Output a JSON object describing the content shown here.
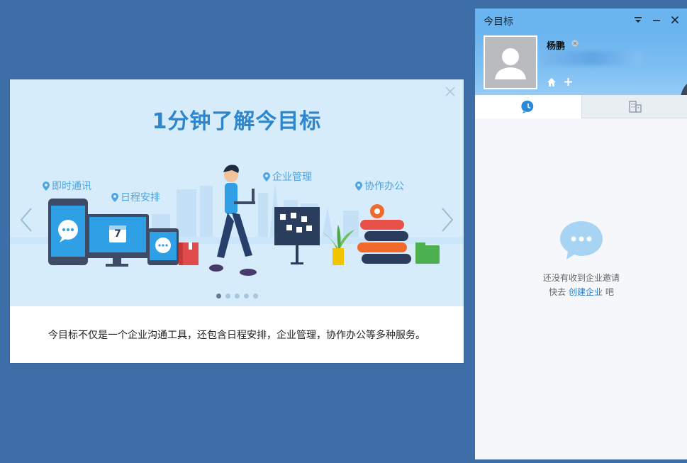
{
  "intro": {
    "title": "1分钟了解今目标",
    "tags": {
      "im": "即时通讯",
      "schedule": "日程安排",
      "enterprise": "企业管理",
      "office": "协作办公"
    },
    "calendar_day": "7",
    "description": "今目标不仅是一个企业沟通工具，还包含日程安排，企业管理，协作办公等多种服务。",
    "pages": 5,
    "active_page": 1
  },
  "client": {
    "app_title": "今目标",
    "user": {
      "name": "杨鹏"
    },
    "empty_state": {
      "line1": "还没有收到企业邀请",
      "prefix": "快去",
      "link": "创建企业",
      "suffix": "吧"
    }
  },
  "colors": {
    "desktop": "#3d6ea8",
    "banner_bg": "#d6ecfb",
    "accent_blue": "#2f86cc",
    "titlebar": "#6ab4ef",
    "link": "#2a7cc7"
  }
}
